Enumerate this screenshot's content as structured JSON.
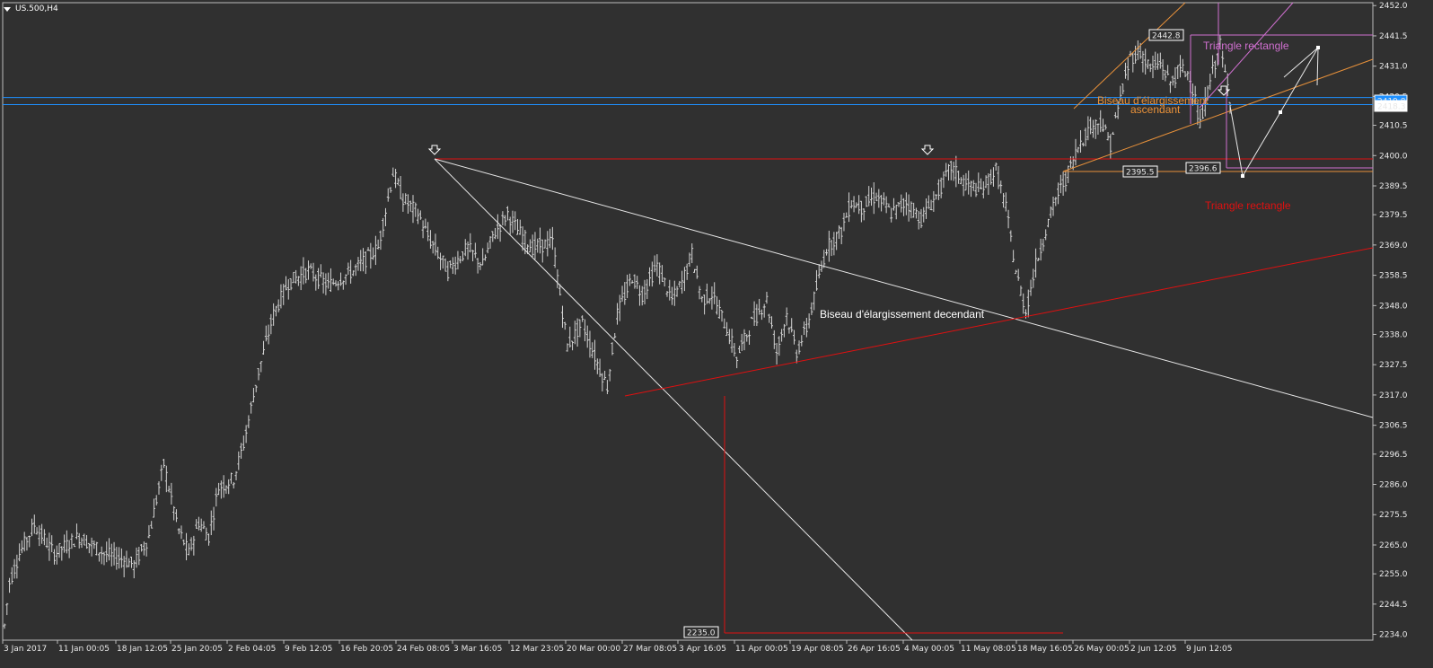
{
  "symbol": "US.500,H4",
  "colors": {
    "background": "#303030",
    "bars": "#d4d4d4",
    "grid_axis": "#ffffff",
    "red_lines": "#e01010",
    "orange_lines": "#e8913a",
    "violet_lines": "#d070d0",
    "blue_lines": "#1e90ff",
    "white_lines": "#e8e8e8"
  },
  "chart_data": {
    "type": "ohlc",
    "ylim": [
      2232,
      2453
    ],
    "y_ticks": [
      "2452.0",
      "2441.5",
      "2431.0",
      "2420.5",
      "2410.5",
      "2400.0",
      "2389.5",
      "2379.5",
      "2369.0",
      "2358.5",
      "2348.0",
      "2338.0",
      "2327.5",
      "2317.0",
      "2306.5",
      "2296.5",
      "2286.0",
      "2275.5",
      "2265.0",
      "2255.0",
      "2244.5",
      "2234.0"
    ],
    "x_labels": [
      "3 Jan 2017",
      "11 Jan 00:05",
      "18 Jan 12:05",
      "25 Jan 20:05",
      "2 Feb 04:05",
      "9 Feb 12:05",
      "16 Feb 20:05",
      "24 Feb 08:05",
      "3 Mar 16:05",
      "12 Mar 23:05",
      "20 Mar 00:00",
      "27 Mar 08:05",
      "3 Apr 16:05",
      "11 Apr 00:05",
      "19 Apr 08:05",
      "26 Apr 16:05",
      "4 May 00:05",
      "11 May 08:05",
      "18 May 16:05",
      "26 May 00:05",
      "2 Jun 12:05",
      "9 Jun 12:05"
    ],
    "price_path": [
      [
        0,
        2237
      ],
      [
        2,
        2252
      ],
      [
        6,
        2262
      ],
      [
        12,
        2272
      ],
      [
        20,
        2262
      ],
      [
        30,
        2268
      ],
      [
        40,
        2262
      ],
      [
        48,
        2260
      ],
      [
        52,
        2258
      ],
      [
        58,
        2268
      ],
      [
        62,
        2285
      ],
      [
        64,
        2293
      ],
      [
        66,
        2285
      ],
      [
        70,
        2270
      ],
      [
        74,
        2262
      ],
      [
        78,
        2273
      ],
      [
        82,
        2268
      ],
      [
        86,
        2285
      ],
      [
        92,
        2288
      ],
      [
        96,
        2300
      ],
      [
        102,
        2325
      ],
      [
        108,
        2345
      ],
      [
        114,
        2356
      ],
      [
        122,
        2360
      ],
      [
        130,
        2355
      ],
      [
        140,
        2360
      ],
      [
        150,
        2368
      ],
      [
        156,
        2394
      ],
      [
        160,
        2385
      ],
      [
        166,
        2380
      ],
      [
        170,
        2372
      ],
      [
        178,
        2360
      ],
      [
        186,
        2368
      ],
      [
        192,
        2362
      ],
      [
        196,
        2372
      ],
      [
        202,
        2380
      ],
      [
        206,
        2374
      ],
      [
        212,
        2368
      ],
      [
        220,
        2370
      ],
      [
        226,
        2334
      ],
      [
        232,
        2342
      ],
      [
        238,
        2328
      ],
      [
        242,
        2320
      ],
      [
        246,
        2345
      ],
      [
        252,
        2358
      ],
      [
        256,
        2352
      ],
      [
        262,
        2362
      ],
      [
        268,
        2350
      ],
      [
        272,
        2356
      ],
      [
        276,
        2366
      ],
      [
        280,
        2350
      ],
      [
        284,
        2352
      ],
      [
        290,
        2340
      ],
      [
        294,
        2330
      ],
      [
        300,
        2342
      ],
      [
        306,
        2350
      ],
      [
        310,
        2332
      ],
      [
        314,
        2345
      ],
      [
        318,
        2332
      ],
      [
        322,
        2340
      ],
      [
        330,
        2368
      ],
      [
        336,
        2374
      ],
      [
        340,
        2384
      ],
      [
        344,
        2382
      ],
      [
        350,
        2386
      ],
      [
        356,
        2380
      ],
      [
        362,
        2384
      ],
      [
        368,
        2378
      ],
      [
        374,
        2386
      ],
      [
        380,
        2396
      ],
      [
        386,
        2390
      ],
      [
        392,
        2388
      ],
      [
        398,
        2395
      ],
      [
        402,
        2382
      ],
      [
        406,
        2360
      ],
      [
        410,
        2346
      ],
      [
        414,
        2362
      ],
      [
        418,
        2374
      ],
      [
        422,
        2385
      ],
      [
        426,
        2392
      ],
      [
        432,
        2405
      ],
      [
        436,
        2410
      ],
      [
        440,
        2412
      ],
      [
        444,
        2404
      ],
      [
        448,
        2420
      ],
      [
        452,
        2434
      ],
      [
        456,
        2436
      ],
      [
        460,
        2430
      ],
      [
        464,
        2432
      ],
      [
        468,
        2425
      ],
      [
        472,
        2430
      ],
      [
        476,
        2428
      ],
      [
        480,
        2410
      ],
      [
        482,
        2418
      ],
      [
        484,
        2426
      ],
      [
        486,
        2432
      ],
      [
        488,
        2438
      ],
      [
        490,
        2428
      ],
      [
        492,
        2420
      ]
    ],
    "horizontal_levels": [
      {
        "price": 2419.8,
        "color": "blue"
      },
      {
        "price": 2418.3,
        "color": "blue"
      },
      {
        "price": 2400.2,
        "color": "red"
      },
      {
        "price": 2395.5,
        "color": "orange"
      },
      {
        "price": 2396.6,
        "color": "violet"
      }
    ],
    "annotations": {
      "descending_wedge": "Biseau d'élargissement decendant",
      "ascending_wedge_line1": "Biseau d'élargissement",
      "ascending_wedge_line2": "ascendant",
      "triangle_violet": "Triangle rectangle",
      "triangle_red": "Triangle rectangle"
    },
    "price_boxes": {
      "high_2442": "2442.8",
      "level_2395": "2395.5",
      "level_2396": "2396.6",
      "low_2235": "2235.0",
      "current_axis": "2418.3",
      "blue_axis": "2419.8"
    }
  }
}
